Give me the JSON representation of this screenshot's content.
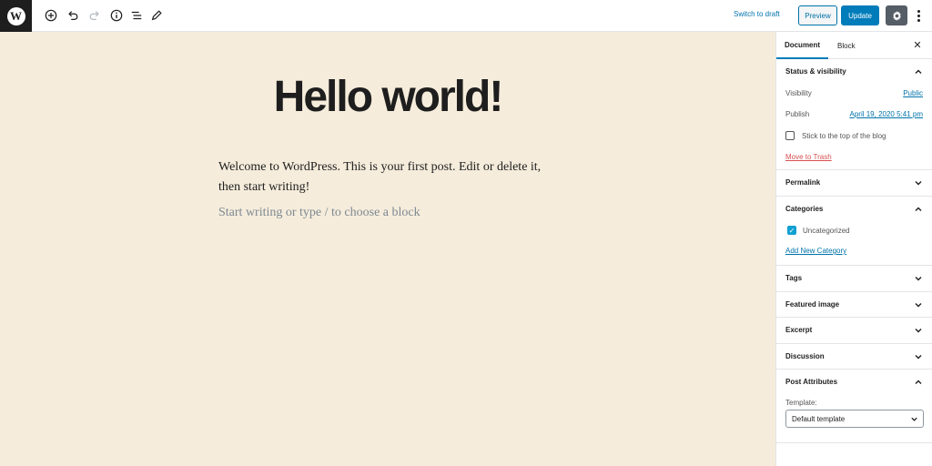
{
  "toolbar": {
    "switch_to_draft": "Switch to draft",
    "preview": "Preview",
    "update": "Update"
  },
  "post": {
    "title": "Hello world!",
    "body": "Welcome to WordPress. This is your first post. Edit or delete it, then start writing!",
    "placeholder": "Start writing or type / to choose a block"
  },
  "sidebar": {
    "tabs": [
      "Document",
      "Block"
    ],
    "status": {
      "heading": "Status & visibility",
      "visibility_label": "Visibility",
      "visibility_value": "Public",
      "publish_label": "Publish",
      "publish_value": "April 19, 2020 5:41 pm",
      "sticky_label": "Stick to the top of the blog",
      "trash": "Move to Trash"
    },
    "permalink": "Permalink",
    "categories": {
      "heading": "Categories",
      "item": "Uncategorized",
      "add_new": "Add New Category"
    },
    "tags": "Tags",
    "featured_image": "Featured image",
    "excerpt": "Excerpt",
    "discussion": "Discussion",
    "post_attributes": {
      "heading": "Post Attributes",
      "template_label": "Template:",
      "template_value": "Default template"
    }
  },
  "colors": {
    "canvas_bg": "#f5ecdb",
    "accent": "#007cba",
    "link": "#0073aa",
    "danger": "#d94f4f"
  }
}
